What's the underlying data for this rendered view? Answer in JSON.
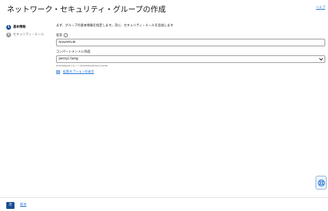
{
  "header": {
    "title": "ネットワーク・セキュリティ・グループの作成",
    "help_label": "ヘルプ"
  },
  "steps": [
    {
      "number": "1",
      "label": "基本情報",
      "active": true
    },
    {
      "number": "2",
      "label": "セキュリティ・ルール",
      "active": false
    }
  ],
  "form": {
    "intro": "まず、グループの基本情報を指定します。次に、セキュリティ・ルールを追加します",
    "name_label": "名前",
    "name_value": "NSGforDB",
    "compartment_label": "コンパートメントに作成",
    "compartment_value": "jenny.l.tang",
    "compartment_path": "oraclejapan (ルート)/member/jenny.l.tang",
    "advanced_label": "拡張オプションの表示"
  },
  "footer": {
    "next_label": "次",
    "cancel_label": "取消"
  },
  "icons": {
    "info": "info-icon",
    "advanced": "sliders-icon",
    "help_widget": "lifebuoy-icon",
    "dropdown": "chevron-down-icon"
  },
  "colors": {
    "primary": "#1c4f92",
    "link": "#1c6fd1",
    "inactive_step": "#9a9894"
  }
}
